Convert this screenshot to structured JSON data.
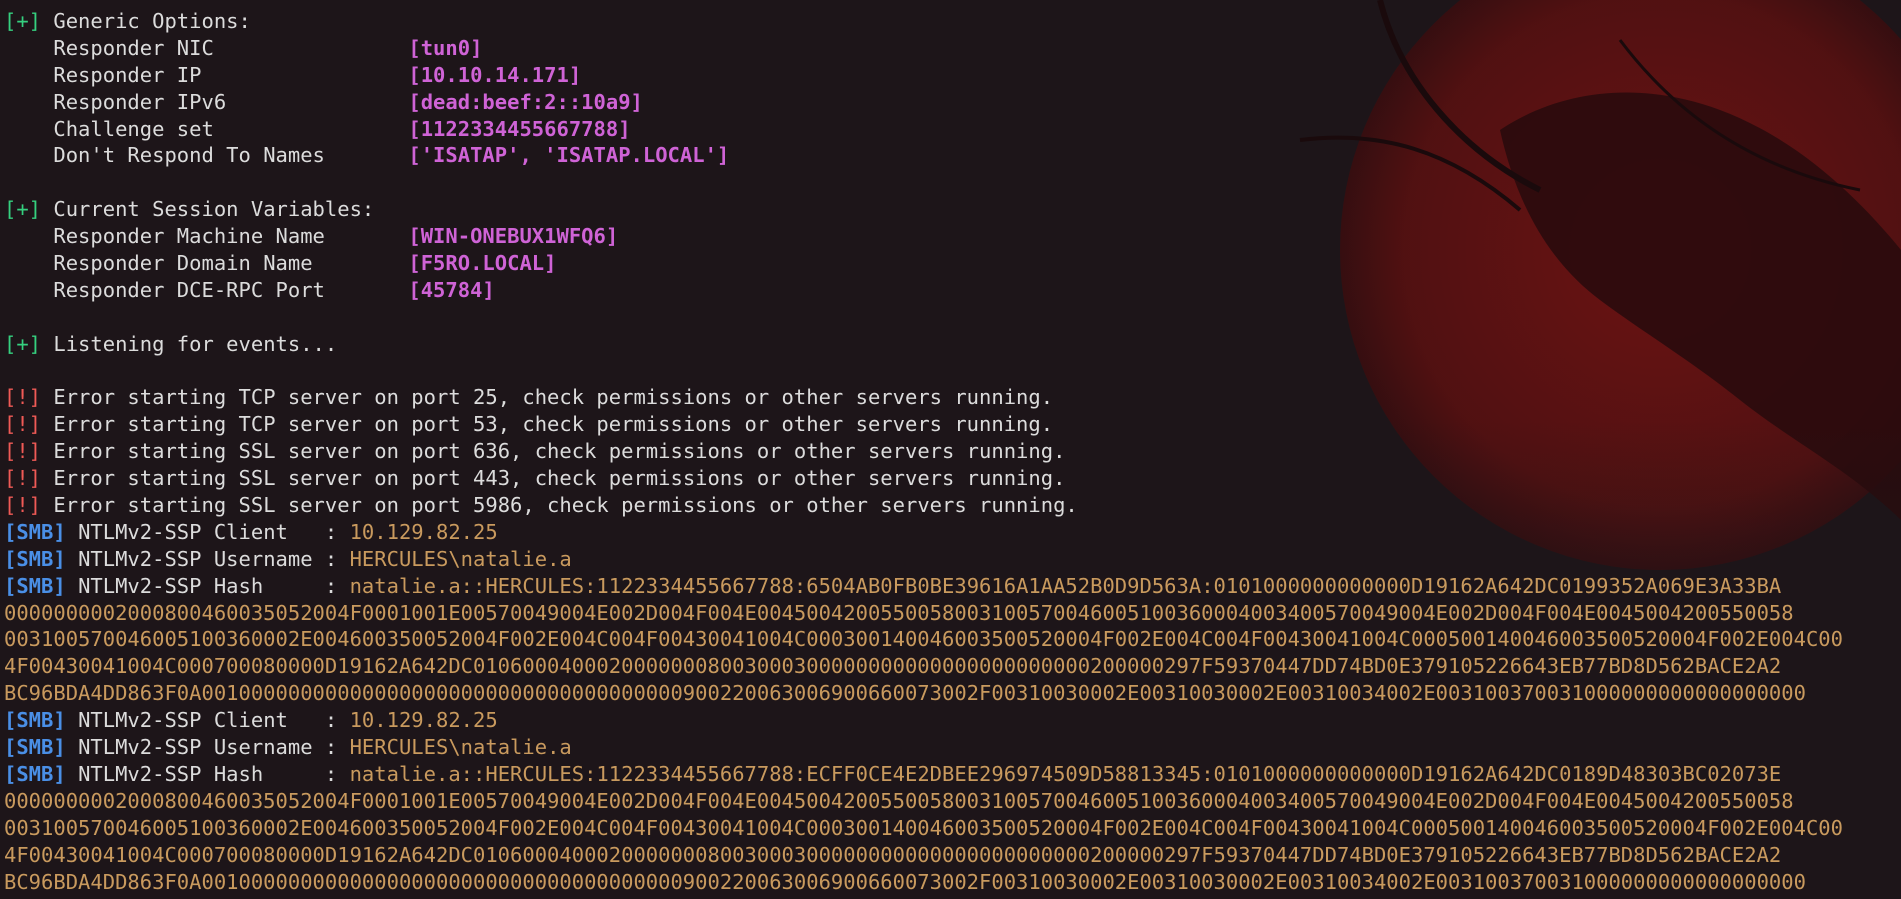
{
  "generic_options": {
    "header": "Generic Options:",
    "items": [
      {
        "label": "Responder NIC",
        "value": "[tun0]"
      },
      {
        "label": "Responder IP",
        "value": "[10.10.14.171]"
      },
      {
        "label": "Responder IPv6",
        "value": "[dead:beef:2::10a9]"
      },
      {
        "label": "Challenge set",
        "value": "[1122334455667788]"
      },
      {
        "label": "Don't Respond To Names",
        "value": "['ISATAP', 'ISATAP.LOCAL']"
      }
    ]
  },
  "session_variables": {
    "header": "Current Session Variables:",
    "items": [
      {
        "label": "Responder Machine Name",
        "value": "[WIN-ONEBUX1WFQ6]"
      },
      {
        "label": "Responder Domain Name",
        "value": "[F5RO.LOCAL]"
      },
      {
        "label": "Responder DCE-RPC Port",
        "value": "[45784]"
      }
    ]
  },
  "status": {
    "plus_tag": "[+]",
    "listening": "Listening for events..."
  },
  "errors": {
    "tag": "[!]",
    "lines": [
      "Error starting TCP server on port 25, check permissions or other servers running.",
      "Error starting TCP server on port 53, check permissions or other servers running.",
      "Error starting SSL server on port 636, check permissions or other servers running.",
      "Error starting SSL server on port 443, check permissions or other servers running.",
      "Error starting SSL server on port 5986, check permissions or other servers running."
    ]
  },
  "smb": {
    "tag": "[SMB]",
    "labels": {
      "client": "NTLMv2-SSP Client   : ",
      "username": "NTLMv2-SSP Username : ",
      "hash": "NTLMv2-SSP Hash     : "
    },
    "captures": [
      {
        "client": "10.129.82.25",
        "username": "HERCULES\\natalie.a",
        "hash_first": "natalie.a::HERCULES:1122334455667788:6504AB0FB0BE39616A1AA52B0D9D563A:0101000000000000D19162A642DC0199352A069E3A33BA",
        "hash_cont": [
          "0000000002000800460035052004F0001001E00570049004E002D004F004E0045004200550058003100570046005100360004003400570049004E002D004F004E0045004200550058",
          "003100570046005100360002E004600350052004F002E004C004F00430041004C000300140046003500520004F002E004C004F00430041004C000500140046003500520004F002E004C00",
          "4F00430041004C000700080000D19162A642DC01060004000200000008003000300000000000000000000000200000297F59370447DD74BD0E379105226643EB77BD8D562BACE2A2",
          "BC96BDA4DD863F0A001000000000000000000000000000000000000900220063006900660073002F00310030002E00310030002E00310034002E003100370031000000000000000000"
        ]
      },
      {
        "client": "10.129.82.25",
        "username": "HERCULES\\natalie.a",
        "hash_first": "natalie.a::HERCULES:1122334455667788:ECFF0CE4E2DBEE296974509D58813345:0101000000000000D19162A642DC0189D48303BC02073E",
        "hash_cont": [
          "0000000002000800460035052004F0001001E00570049004E002D004F004E0045004200550058003100570046005100360004003400570049004E002D004F004E0045004200550058",
          "003100570046005100360002E004600350052004F002E004C004F00430041004C000300140046003500520004F002E004C004F00430041004C000500140046003500520004F002E004C00",
          "4F00430041004C000700080000D19162A642DC01060004000200000008003000300000000000000000000000200000297F59370447DD74BD0E379105226643EB77BD8D562BACE2A2",
          "BC96BDA4DD863F0A001000000000000000000000000000000000000900220063006900660073002F00310030002E00310030002E00310034002E003100370031000000000000000000"
        ]
      }
    ]
  },
  "colors": {
    "background": "#1d1519",
    "tag_green": "#35d07f",
    "tag_red": "#f05a56",
    "tag_blue": "#4a8fe6",
    "value_magenta": "#cf63d6",
    "value_orange": "#c99a5e",
    "text": "#dcdcdc"
  }
}
